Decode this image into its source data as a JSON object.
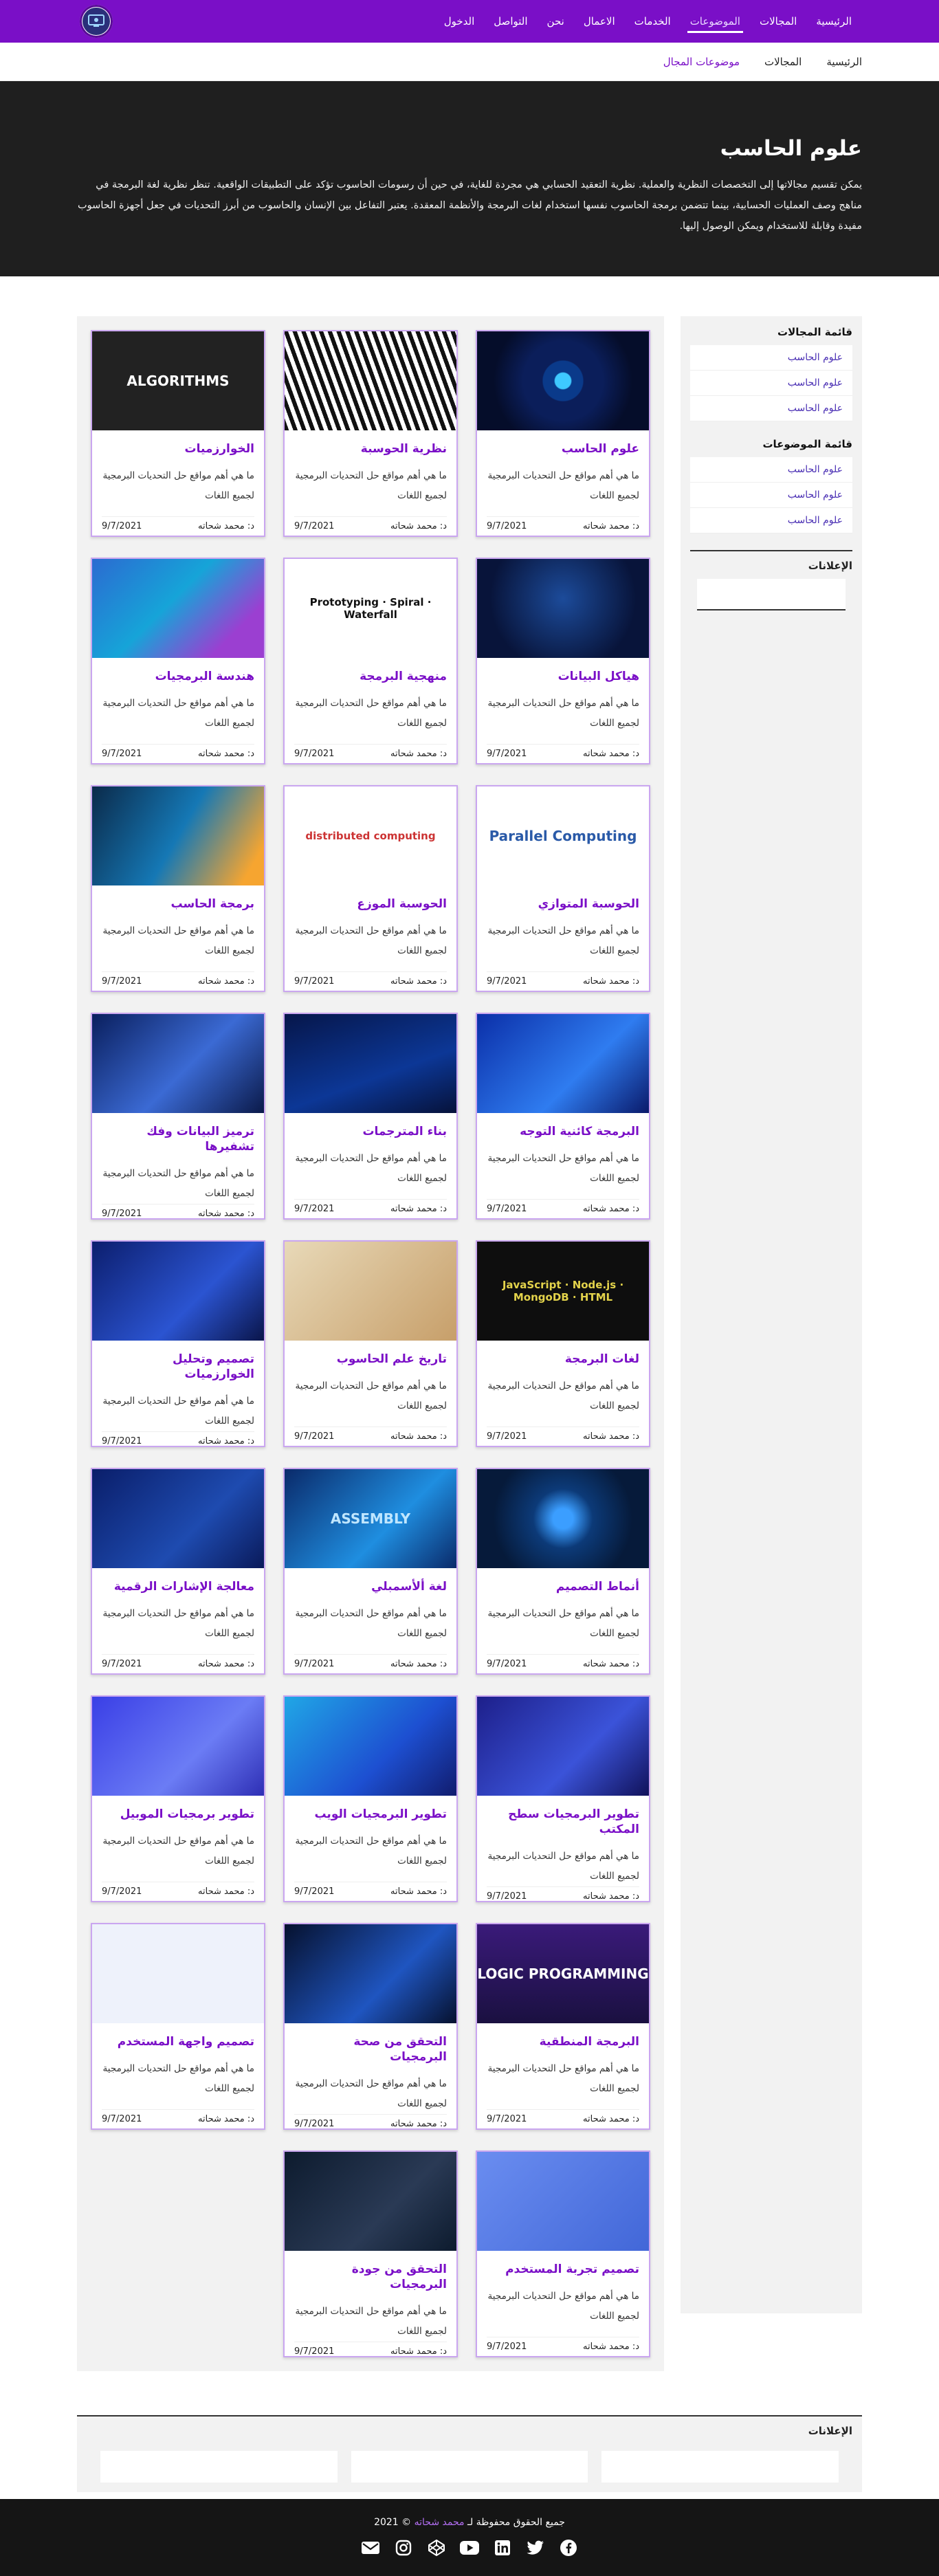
{
  "nav": {
    "links": [
      "الرئيسية",
      "المجالات",
      "الموضوعات",
      "الخدمات",
      "الاعمال",
      "نحن",
      "التواصل",
      "الدخول"
    ],
    "active_index": 2,
    "logo_icon": "monitor-logo-icon"
  },
  "subnav": {
    "links": [
      "الرئيسية",
      "المجالات",
      "موضوعات المجال"
    ],
    "active_index": 2
  },
  "hero": {
    "title": "علوم الحاسب",
    "description": "يمكن تقسيم مجالاتها إلى التخصصات النظرية والعملية. نظرية التعقيد الحسابي هي مجردة للغاية، في حين أن رسومات الحاسوب تؤكد على التطبيقات الواقعية. تنظر نظرية لغة البرمجة في مناهج وصف العمليات الحسابية، بينما تتضمن برمجة الحاسوب نفسها استخدام لغات البرمجة والأنظمة المعقدة. يعتبر التفاعل بين الإنسان والحاسوب من أبرز التحديات في جعل أجهزة الحاسوب مفيدة وقابلة للاستخدام ويمكن الوصول إليها."
  },
  "sidebar": {
    "fields_title": "قائمة المجالات",
    "fields": [
      "علوم الحاسب",
      "علوم الحاسب",
      "علوم الحاسب"
    ],
    "topics_title": "قائمة الموضوعات",
    "topics": [
      "علوم الحاسب",
      "علوم الحاسب",
      "علوم الحاسب"
    ],
    "ads_title": "الإعلانات"
  },
  "cards": [
    {
      "title": "علوم الحاسب",
      "img": "tech-circle",
      "desc": "ما هي أهم مواقع حل التحديات البرمجية لجميع اللغات",
      "author": "د: محمد شحاته",
      "date": "9/7/2021"
    },
    {
      "title": "نظرية الحوسبة",
      "img": "ribbon",
      "desc": "ما هي أهم مواقع حل التحديات البرمجية لجميع اللغات",
      "author": "د: محمد شحاته",
      "date": "9/7/2021"
    },
    {
      "title": "الخوارزميات",
      "img": "algorithms",
      "img_text": "ALGORITHMS",
      "desc": "ما هي أهم مواقع حل التحديات البرمجية لجميع اللغات",
      "author": "د: محمد شحاته",
      "date": "9/7/2021"
    },
    {
      "title": "هياكل البيانات",
      "img": "tree",
      "desc": "ما هي أهم مواقع حل التحديات البرمجية لجميع اللغات",
      "author": "د: محمد شحاته",
      "date": "9/7/2021"
    },
    {
      "title": "منهجية البرمجة",
      "img": "diagrams",
      "img_text": "Prototyping · Spiral · Waterfall",
      "desc": "ما هي أهم مواقع حل التحديات البرمجية لجميع اللغات",
      "author": "د: محمد شحاته",
      "date": "9/7/2021"
    },
    {
      "title": "هندسة البرمجيات",
      "img": "iso-city",
      "desc": "ما هي أهم مواقع حل التحديات البرمجية لجميع اللغات",
      "author": "د: محمد شحاته",
      "date": "9/7/2021"
    },
    {
      "title": "الحوسبة المتوازي",
      "img": "wordcloud",
      "img_text": "Parallel Computing",
      "desc": "ما هي أهم مواقع حل التحديات البرمجية لجميع اللغات",
      "author": "د: محمد شحاته",
      "date": "9/7/2021"
    },
    {
      "title": "الحوسبة الموزع",
      "img": "distributed",
      "img_text": "distributed computing",
      "desc": "ما هي أهم مواقع حل التحديات البرمجية لجميع اللغات",
      "author": "د: محمد شحاته",
      "date": "9/7/2021"
    },
    {
      "title": "برمجة الحاسب",
      "img": "code-screen",
      "desc": "ما هي أهم مواقع حل التحديات البرمجية لجميع اللغات",
      "author": "د: محمد شحاته",
      "date": "9/7/2021"
    },
    {
      "title": "البرمجة كائنية التوجه",
      "img": "binary-blue",
      "desc": "ما هي أهم مواقع حل التحديات البرمجية لجميع اللغات",
      "author": "د: محمد شحاته",
      "date": "9/7/2021"
    },
    {
      "title": "بناء المترجمات",
      "img": "binary-dark",
      "desc": "ما هي أهم مواقع حل التحديات البرمجية لجميع اللغات",
      "author": "د: محمد شحاته",
      "date": "9/7/2021"
    },
    {
      "title": "ترميز البيانات وفك تشفيرها",
      "img": "binary-grid",
      "desc": "ما هي أهم مواقع حل التحديات البرمجية لجميع اللغات",
      "author": "د: محمد شحاته",
      "date": "9/7/2021"
    },
    {
      "title": "لغات البرمجة",
      "img": "languages",
      "img_text": "JavaScript · Node.js · MongoDB · HTML",
      "desc": "ما هي أهم مواقع حل التحديات البرمجية لجميع اللغات",
      "author": "د: محمد شحاته",
      "date": "9/7/2021"
    },
    {
      "title": "تاريخ علم الحاسوب",
      "img": "history",
      "desc": "ما هي أهم مواقع حل التحديات البرمجية لجميع اللغات",
      "author": "د: محمد شحاته",
      "date": "9/7/2021"
    },
    {
      "title": "تصميم وتحليل الخوارزميات",
      "img": "circuit",
      "desc": "ما هي أهم مواقع حل التحديات البرمجية لجميع اللغات",
      "author": "د: محمد شحاته",
      "date": "9/7/2021"
    },
    {
      "title": "أنماط التصميم",
      "img": "pattern-circle",
      "desc": "ما هي أهم مواقع حل التحديات البرمجية لجميع اللغات",
      "author": "د: محمد شحاته",
      "date": "9/7/2021"
    },
    {
      "title": "لغة ألأسمبلي",
      "img": "assembly",
      "img_text": "ASSEMBLY",
      "desc": "ما هي أهم مواقع حل التحديات البرمجية لجميع اللغات",
      "author": "د: محمد شحاته",
      "date": "9/7/2021"
    },
    {
      "title": "معالجة الإشارات الرقمية",
      "img": "wave",
      "desc": "ما هي أهم مواقع حل التحديات البرمجية لجميع اللغات",
      "author": "د: محمد شحاته",
      "date": "9/7/2021"
    },
    {
      "title": "تطوير البرمجيات سطح المكتب",
      "img": "desktop",
      "desc": "ما هي أهم مواقع حل التحديات البرمجية لجميع اللغات",
      "author": "د: محمد شحاته",
      "date": "9/7/2021"
    },
    {
      "title": "تطوير البرمجيات الويب",
      "img": "laptop",
      "desc": "ما هي أهم مواقع حل التحديات البرمجية لجميع اللغات",
      "author": "د: محمد شحاته",
      "date": "9/7/2021"
    },
    {
      "title": "تطوير برمجيات الموبيل",
      "img": "mobile",
      "desc": "ما هي أهم مواقع حل التحديات البرمجية لجميع اللغات",
      "author": "د: محمد شحاته",
      "date": "9/7/2021"
    },
    {
      "title": "البرمجة المنطقية",
      "img": "logic",
      "img_text": "LOGIC PROGRAMMING",
      "desc": "ما هي أهم مواقع حل التحديات البرمجية لجميع اللغات",
      "author": "د: محمد شحاته",
      "date": "9/7/2021"
    },
    {
      "title": "التحقق من صحة البرمجيات",
      "img": "touch",
      "desc": "ما هي أهم مواقع حل التحديات البرمجية لجميع اللغات",
      "author": "د: محمد شحاته",
      "date": "9/7/2021"
    },
    {
      "title": "تصميم واجهة المستخدم",
      "img": "ui-screens",
      "desc": "ما هي أهم مواقع حل التحديات البرمجية لجميع اللغات",
      "author": "د: محمد شحاته",
      "date": "9/7/2021"
    },
    {
      "title": "تصميم تجربة المستخدم",
      "img": "phones",
      "desc": "ما هي أهم مواقع حل التحديات البرمجية لجميع اللغات",
      "author": "د: محمد شحاته",
      "date": "9/7/2021"
    },
    {
      "title": "التحقق من جودة البرمجيات",
      "img": "quality",
      "desc": "ما هي أهم مواقع حل التحديات البرمجية لجميع اللغات",
      "author": "د: محمد شحاته",
      "date": "9/7/2021"
    }
  ],
  "bottom_ads": {
    "title": "الإعلانات"
  },
  "footer": {
    "copyright_prefix": "جميع الحقوق محفوظة لـ",
    "author": "محمد شحاته",
    "copyright_suffix": "© 2021",
    "social_icons": [
      "facebook-icon",
      "twitter-icon",
      "linkedin-icon",
      "youtube-icon",
      "codepen-icon",
      "instagram-icon",
      "email-icon"
    ]
  },
  "colors": {
    "brand": "#7a0fc7",
    "hero_bg": "#1f1f1f",
    "footer_bg": "#151515",
    "card_border": "#caa6f0",
    "sidebar_link": "#4a2fb4"
  }
}
